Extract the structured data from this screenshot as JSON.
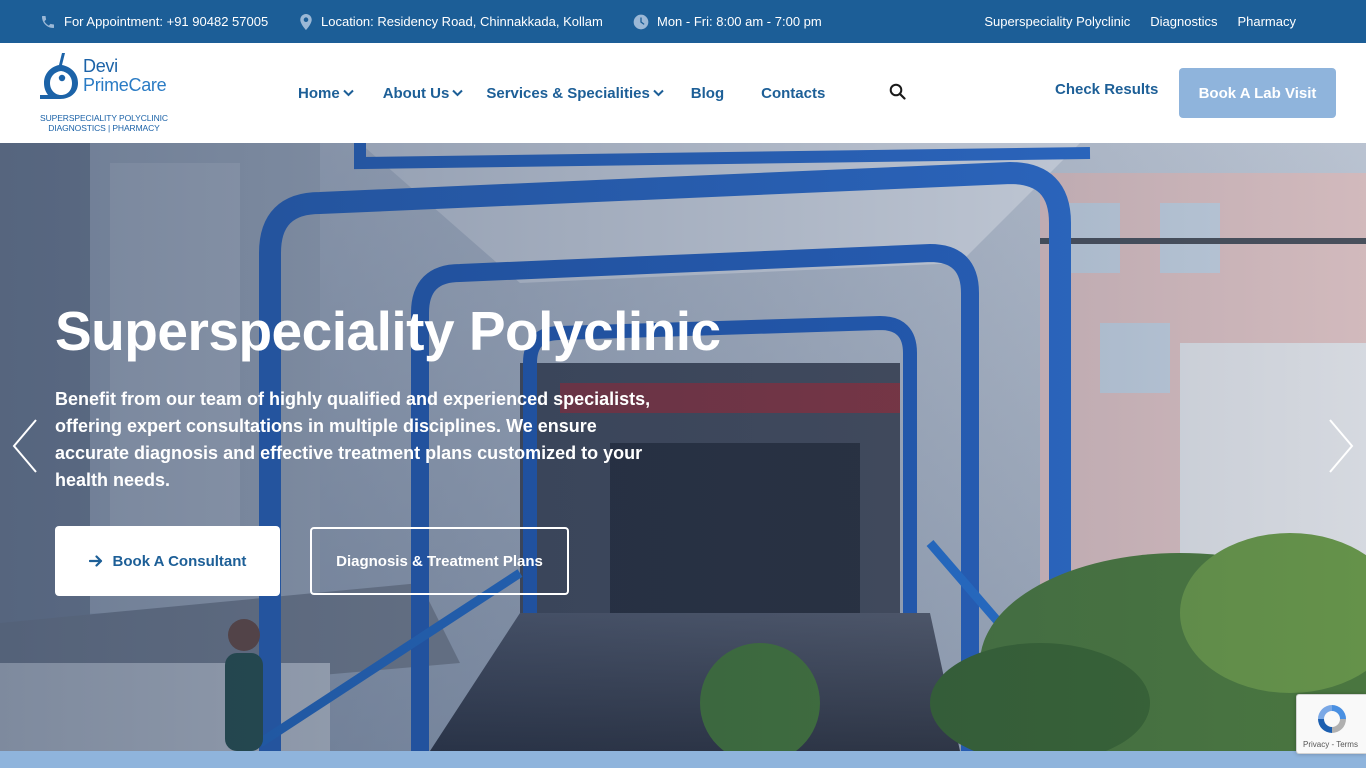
{
  "topbar": {
    "phone": "For Appointment: +91 90482 57005",
    "location": "Location: Residency Road, Chinnakkada, Kollam",
    "hours": "Mon - Fri: 8:00 am - 7:00 pm",
    "links": [
      "Superspeciality Polyclinic",
      "Diagnostics",
      "Pharmacy"
    ],
    "background": "#1c5e97"
  },
  "logo": {
    "name_line1": "Devi",
    "name_line2": "PrimeCare",
    "tagline_line1": "SUPERSPECIALITY POLYCLINIC",
    "tagline_line2": "DIAGNOSTICS | PHARMACY",
    "color": "#1c63a8"
  },
  "nav": {
    "items": [
      {
        "label": "Home",
        "dropdown": true
      },
      {
        "label": "About Us",
        "dropdown": true
      },
      {
        "label": "Services & Specialities",
        "dropdown": true
      },
      {
        "label": "Blog",
        "dropdown": false
      },
      {
        "label": "Contacts",
        "dropdown": false
      }
    ],
    "search_icon": "search-icon",
    "check_results": "Check Results",
    "book_lab": "Book A Lab Visit",
    "accent": "#8fb4dc"
  },
  "hero": {
    "title": "Superspeciality Polyclinic",
    "text": "Benefit from our team of highly qualified and experienced specialists, offering expert consultations in multiple disciplines. We ensure accurate diagnosis and effective treatment plans customized to your health needs.",
    "primary_button": "Book A Consultant",
    "secondary_button": "Diagnosis & Treatment Plans",
    "prev_icon": "chevron-left-icon",
    "next_icon": "chevron-right-icon"
  },
  "recaptcha": {
    "terms": "Privacy - Terms"
  }
}
